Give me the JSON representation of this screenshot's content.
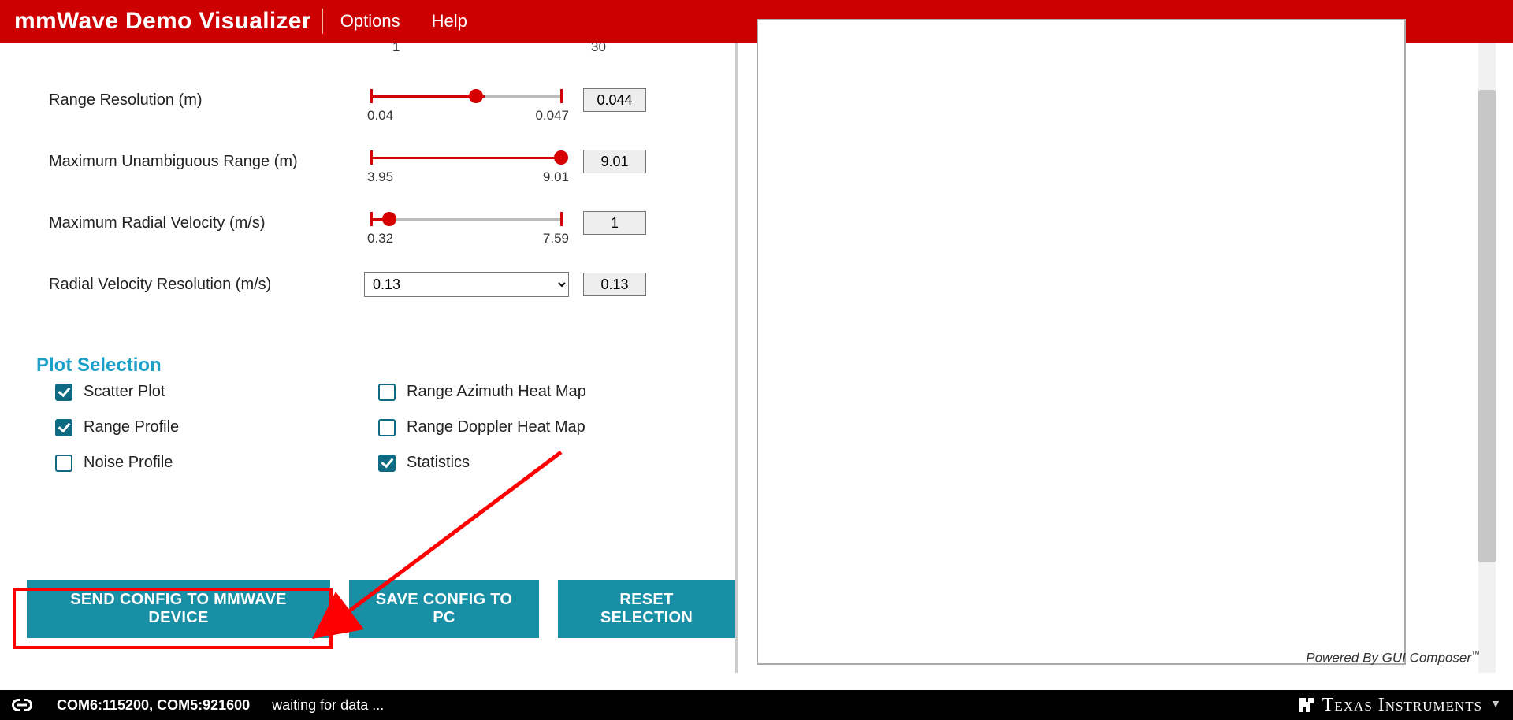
{
  "header": {
    "title": "mmWave Demo Visualizer",
    "menu": {
      "options": "Options",
      "help": "Help"
    }
  },
  "top_ticks": {
    "left": "1",
    "right": "30"
  },
  "sliders": {
    "range_res": {
      "label": "Range Resolution (m)",
      "min": "0.04",
      "max": "0.047",
      "value": "0.044",
      "frac": 0.55
    },
    "max_range": {
      "label": "Maximum Unambiguous Range (m)",
      "min": "3.95",
      "max": "9.01",
      "value": "9.01",
      "frac": 1.0
    },
    "max_vel": {
      "label": "Maximum Radial Velocity (m/s)",
      "min": "0.32",
      "max": "7.59",
      "value": "1",
      "frac": 0.09
    }
  },
  "radial_res": {
    "label": "Radial Velocity Resolution (m/s)",
    "selected": "0.13",
    "value": "0.13"
  },
  "plot_section_title": "Plot Selection",
  "plots": {
    "scatter": {
      "label": "Scatter Plot",
      "checked": true
    },
    "range_prof": {
      "label": "Range Profile",
      "checked": true
    },
    "noise_prof": {
      "label": "Noise Profile",
      "checked": false
    },
    "azimuth": {
      "label": "Range Azimuth Heat Map",
      "checked": false
    },
    "doppler": {
      "label": "Range Doppler Heat Map",
      "checked": false
    },
    "stats": {
      "label": "Statistics",
      "checked": true
    }
  },
  "buttons": {
    "send": "SEND CONFIG TO MMWAVE DEVICE",
    "save": "SAVE CONFIG TO PC",
    "reset": "RESET SELECTION"
  },
  "powered_by": "Powered By GUI Composer",
  "status": {
    "com": "COM6:115200, COM5:921600",
    "msg": "waiting for data ...",
    "logo_text": "Texas Instruments"
  }
}
